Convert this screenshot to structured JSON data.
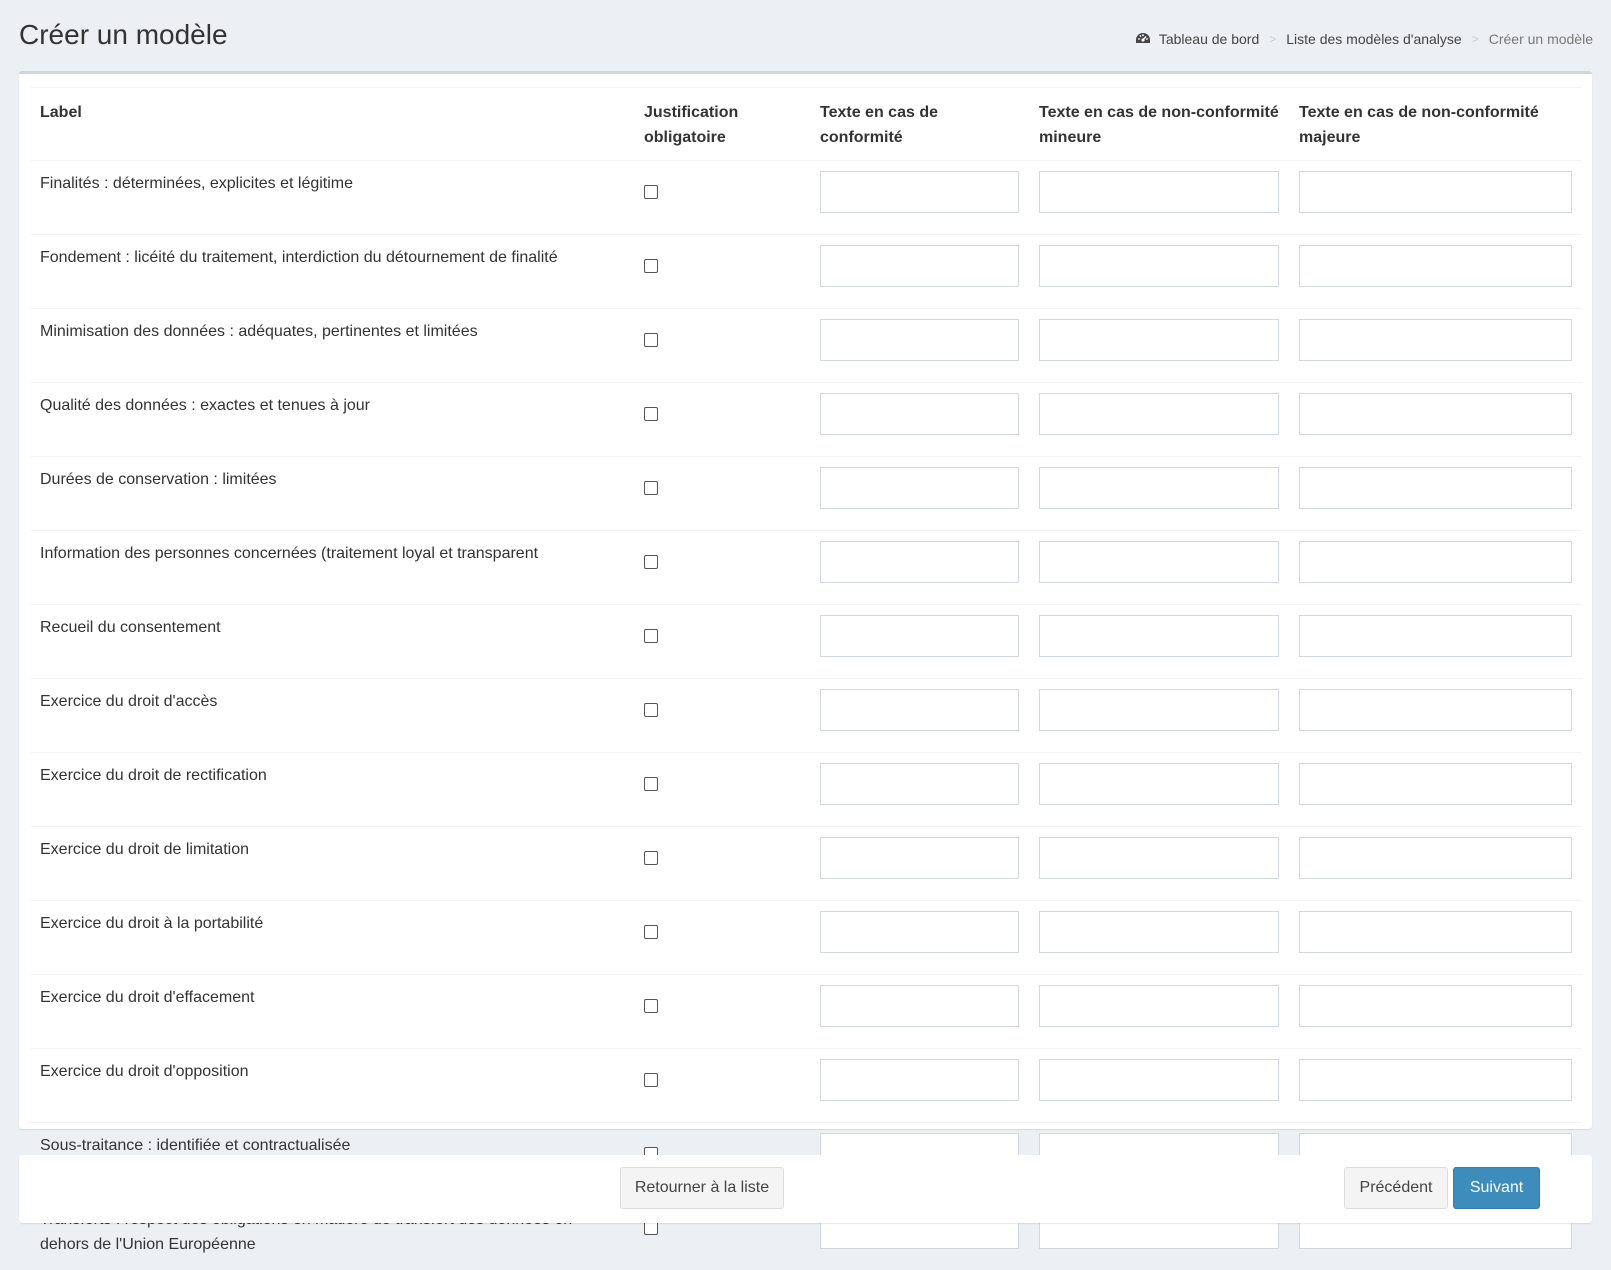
{
  "header": {
    "title": "Créer un modèle"
  },
  "breadcrumb": {
    "items": [
      {
        "label": "Tableau de bord",
        "icon": "dashboard-icon"
      },
      {
        "label": "Liste des modèles d'analyse"
      },
      {
        "label": "Créer un modèle"
      }
    ],
    "separator": ">"
  },
  "table": {
    "columns": [
      "Label",
      "Justification obligatoire",
      "Texte en cas de conformité",
      "Texte en cas de non-conformité mineure",
      "Texte en cas de non-conformité majeure"
    ],
    "rows": [
      {
        "label": "Finalités : déterminées, explicites et légitime",
        "checked": false
      },
      {
        "label": "Fondement : licéité du traitement, interdiction du détournement de finalité",
        "checked": false
      },
      {
        "label": "Minimisation des données : adéquates, pertinentes et limitées",
        "checked": false
      },
      {
        "label": "Qualité des données : exactes et tenues à jour",
        "checked": false
      },
      {
        "label": "Durées de conservation : limitées",
        "checked": false
      },
      {
        "label": "Information des personnes concernées (traitement loyal et transparent",
        "checked": false
      },
      {
        "label": "Recueil du consentement",
        "checked": false
      },
      {
        "label": "Exercice du droit d'accès",
        "checked": false
      },
      {
        "label": "Exercice du droit de rectification",
        "checked": false
      },
      {
        "label": "Exercice du droit de limitation",
        "checked": false
      },
      {
        "label": "Exercice du droit à la portabilité",
        "checked": false
      },
      {
        "label": "Exercice du droit d'effacement",
        "checked": false
      },
      {
        "label": "Exercice du droit d'opposition",
        "checked": false
      },
      {
        "label": "Sous-traitance : identifiée et contractualisée",
        "checked": false
      },
      {
        "label": "Transferts : respect des obligations en matière de transfert des données en dehors de l'Union Européenne",
        "checked": false
      }
    ]
  },
  "footer": {
    "back_label": "Retourner à la liste",
    "previous_label": "Précédent",
    "next_label": "Suivant"
  },
  "colors": {
    "background": "#ecf0f5",
    "primary": "#3c8dbc",
    "box_border_top": "#d2d6de"
  }
}
